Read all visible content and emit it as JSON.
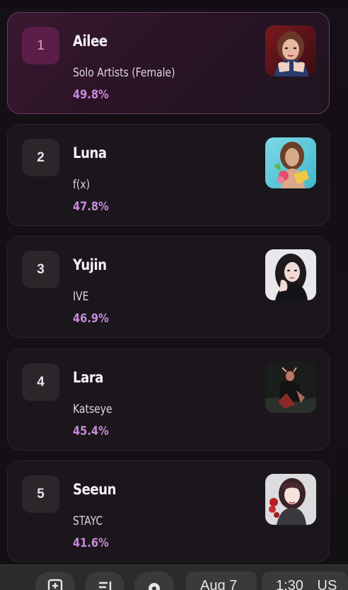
{
  "ranking": [
    {
      "rank": "1",
      "name": "Ailee",
      "group": "Solo Artists (Female)",
      "percent": "49.8%"
    },
    {
      "rank": "2",
      "name": "Luna",
      "group": "f(x)",
      "percent": "47.8%"
    },
    {
      "rank": "3",
      "name": "Yujin",
      "group": "IVE",
      "percent": "46.9%"
    },
    {
      "rank": "4",
      "name": "Lara",
      "group": "Katseye",
      "percent": "45.4%"
    },
    {
      "rank": "5",
      "name": "Seeun",
      "group": "STAYC",
      "percent": "41.6%"
    }
  ],
  "taskbar": {
    "date": "Aug 7",
    "time": "1:30",
    "region": "US"
  },
  "colors": {
    "accent_percent": "#c88ad9",
    "highlight_border": "#6a3a5e",
    "card_bg": "#1a161c"
  }
}
